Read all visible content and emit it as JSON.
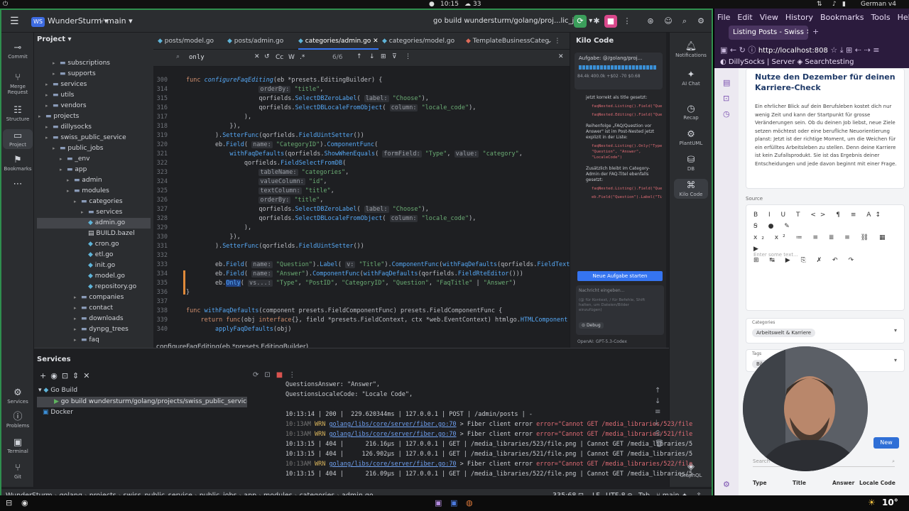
{
  "topbar": {
    "clock": "10:15",
    "temp": "33",
    "keyboard": "German v4"
  },
  "ide": {
    "project_badge": "WS",
    "project": "WunderSturm",
    "branch": "main",
    "run_config": "go build wundersturm/golang/proj...lic_jobs",
    "strip": [
      "Commit",
      "Merge Request",
      "Structure",
      "Project",
      "Bookmarks"
    ],
    "right_strip": [
      "Notifications",
      "AI Chat",
      "Recap",
      "PlantUML",
      "DB",
      "Kilo Code",
      "GraphQL"
    ],
    "project_title": "Project",
    "tree": [
      {
        "label": "subscriptions",
        "indent": 4,
        "type": "folder"
      },
      {
        "label": "supports",
        "indent": 4,
        "type": "folder"
      },
      {
        "label": "services",
        "indent": 3,
        "type": "folder"
      },
      {
        "label": "utils",
        "indent": 3,
        "type": "folder"
      },
      {
        "label": "vendors",
        "indent": 3,
        "type": "folder"
      },
      {
        "label": "projects",
        "indent": 2,
        "type": "folder"
      },
      {
        "label": "dillysocks",
        "indent": 3,
        "type": "folder"
      },
      {
        "label": "swiss_public_service",
        "indent": 3,
        "type": "folder"
      },
      {
        "label": "public_jobs",
        "indent": 4,
        "type": "folder"
      },
      {
        "label": "_env",
        "indent": 5,
        "type": "folder"
      },
      {
        "label": "app",
        "indent": 5,
        "type": "folder"
      },
      {
        "label": "admin",
        "indent": 6,
        "type": "folder"
      },
      {
        "label": "modules",
        "indent": 6,
        "type": "folder"
      },
      {
        "label": "categories",
        "indent": 7,
        "type": "folder"
      },
      {
        "label": "services",
        "indent": 8,
        "type": "folder"
      },
      {
        "label": "admin.go",
        "indent": 8,
        "type": "go",
        "selected": true
      },
      {
        "label": "BUILD.bazel",
        "indent": 8,
        "type": "file"
      },
      {
        "label": "cron.go",
        "indent": 8,
        "type": "go"
      },
      {
        "label": "etl.go",
        "indent": 8,
        "type": "go"
      },
      {
        "label": "init.go",
        "indent": 8,
        "type": "go"
      },
      {
        "label": "model.go",
        "indent": 8,
        "type": "go"
      },
      {
        "label": "repository.go",
        "indent": 8,
        "type": "go"
      },
      {
        "label": "companies",
        "indent": 7,
        "type": "folder"
      },
      {
        "label": "contact",
        "indent": 7,
        "type": "folder"
      },
      {
        "label": "downloads",
        "indent": 7,
        "type": "folder"
      },
      {
        "label": "dynpg_trees",
        "indent": 7,
        "type": "folder"
      },
      {
        "label": "faq",
        "indent": 7,
        "type": "folder"
      }
    ],
    "tabs": [
      "posts/model.go",
      "posts/admin.go",
      "categories/admin.go",
      "categories/model.go",
      "TemplateBusinessCateg"
    ],
    "find": {
      "query": "only",
      "count": "6/6",
      "cc": "Cc",
      "w": "W",
      "regex": ".*"
    },
    "breadcrumb_fn": "configureFaqEditing(eb *presets.EditingBuilder)",
    "line_numbers": [
      "300",
      "314",
      "315",
      "316",
      "317",
      "318",
      "319",
      "320",
      "321",
      "322",
      "323",
      "324",
      "325",
      "326",
      "327",
      "328",
      "329",
      "330",
      "331",
      "332",
      "333",
      "334",
      "335",
      "336",
      "337",
      "338",
      "339",
      "340"
    ],
    "kilo": {
      "title": "Kilo Code",
      "task": "Aufgabe: @/golang/proj...",
      "stats": "84.4k  400.0k  +$02  -70  $0.68",
      "msg1": "jetzt korrekt als title gesetzt:",
      "b1": "faqNested.Listing().Field(\"Question\").Label(\"Title\")",
      "b2": "faqNested.Editing().Field(\"Question\").Label(\"Title\")",
      "msg2": "Reihenfolge „FAQ/Question vor Answer\" ist im Post-Nested jetzt explizit in der Liste:",
      "b3": "faqNested.Listing().Only(\"Type\", \"Question\", \"Answer\", \"LocaleCode\")",
      "msg3": "Zusätzlich bleibt im Category-Admin der FAQ-Titel ebenfalls gesetzt:",
      "b4": "faqNested.Listing().Field(\"Question\").Label(\"Title\")",
      "b5": "eb.Field(\"Question\").Label(\"Title\")",
      "new_task": "Neue Aufgabe starten",
      "input_ph": "Nachricht eingeben...",
      "input_hint": "(@ für Kontext, / für Befehle, Shift halten, um Dateien/Bilder einzufügen)",
      "mode": "Debug",
      "model": "OpenAI: GPT-5.3-Codex"
    },
    "services": {
      "title": "Services",
      "go_build": "Go Build",
      "run_item": "go build wundersturm/golang/projects/swiss_public_service/p",
      "docker": "Docker"
    },
    "status": {
      "path": [
        "WunderSturm",
        "golang",
        "projects",
        "swiss_public_service",
        "public_jobs",
        "app",
        "modules",
        "categories",
        "admin.go"
      ],
      "pos": "335:68",
      "lf": "LF",
      "enc": "UTF-8",
      "indent": "Tab",
      "branch": "main"
    }
  },
  "logs": [
    {
      "text": "QuestionsAnswer: \"Answer\","
    },
    {
      "text": "QuestionsLocaleCode: \"Locale Code\","
    },
    {
      "text": ""
    },
    {
      "text": "10:13:14 | 200 |  229.620344ms | 127.0.0.1 | POST | /admin/posts | -"
    },
    {
      "time": "10:13AM",
      "lvl": "WRN",
      "link": "golang/libs/core/server/fiber.go:70",
      "msg": " > Fiber client error ",
      "err": "error=\"Cannot GET /media_libraries/523/file"
    },
    {
      "time": "10:13AM",
      "lvl": "WRN",
      "link": "golang/libs/core/server/fiber.go:70",
      "msg": " > Fiber client error ",
      "err": "error=\"Cannot GET /media_libraries/521/file"
    },
    {
      "text": "10:13:15 | 404 |      216.16µs | 127.0.0.1 | GET | /media_libraries/523/file.png | Cannot GET /media_libraries/5"
    },
    {
      "text": "10:13:15 | 404 |     126.902µs | 127.0.0.1 | GET | /media_libraries/521/file.png | Cannot GET /media_libraries/5"
    },
    {
      "time": "10:13AM",
      "lvl": "WRN",
      "link": "golang/libs/core/server/fiber.go:70",
      "msg": " > Fiber client error ",
      "err": "error=\"Cannot GET /media_libraries/522/file"
    },
    {
      "text": "10:13:15 | 404 |      216.09µs | 127.0.0.1 | GET | /media_libraries/522/file.png | Cannot GET /media_libraries/5"
    }
  ],
  "firefox": {
    "menu": [
      "File",
      "Edit",
      "View",
      "History",
      "Bookmarks",
      "Tools",
      "Help"
    ],
    "tab": "Listing Posts - Swiss",
    "url": "http://localhost:808",
    "bookmarks": [
      "DillySocks | Server",
      "Searchtesting"
    ],
    "heading": "Nutze den Dezember für deinen Karriere-Check",
    "body": "Ein ehrlicher Blick auf dein Berufsleben kostet dich nur wenig Zeit und kann der Startpunkt für grosse Veränderungen sein. Ob du deinen Job liebst, neue Ziele setzen möchtest oder eine berufliche Neuorientierung planst: Jetzt ist der richtige Moment, um die Weichen für ein erfülltes Arbeitsleben zu stellen. Denn deine Karriere ist kein Zufallsprodukt. Sie ist das Ergebnis deiner Entscheidungen und jede davon beginnt mit einer Frage.",
    "source_label": "Source",
    "editor_ph": "Enter some text...",
    "categories_label": "Categories",
    "category_chip": "Arbeitswelt & Karriere",
    "tags_label": "Tags",
    "tag_chip": "Bildung",
    "new_btn": "New",
    "search_ph": "Search",
    "cols": [
      "Type",
      "Title",
      "Answer",
      "Locale Code"
    ]
  },
  "dock": {
    "weather": "10°"
  }
}
